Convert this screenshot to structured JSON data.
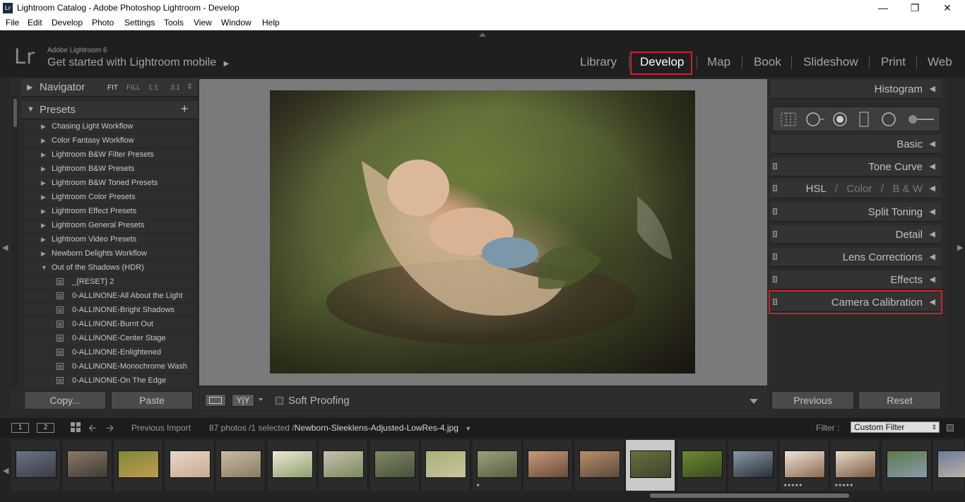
{
  "window": {
    "title": "Lightroom Catalog - Adobe Photoshop Lightroom - Develop",
    "app_icon": "Lr",
    "controls": {
      "minimize": "—",
      "restore": "❐",
      "close": "✕"
    }
  },
  "menu": [
    "File",
    "Edit",
    "Develop",
    "Photo",
    "Settings",
    "Tools",
    "View",
    "Window",
    "Help"
  ],
  "identity": {
    "logo": "Lr",
    "brand": "Adobe Lightroom 6",
    "mobile_prompt": "Get started with Lightroom mobile",
    "mobile_arrow": "▶"
  },
  "modules": [
    "Library",
    "Develop",
    "Map",
    "Book",
    "Slideshow",
    "Print",
    "Web"
  ],
  "active_module": "Develop",
  "left_panel": {
    "navigator": {
      "label": "Navigator",
      "options": [
        "FIT",
        "FILL",
        "1:1",
        "3:1"
      ],
      "selected": "FIT"
    },
    "presets": {
      "label": "Presets",
      "add": "+",
      "items": [
        {
          "name": "Chasing Light Workflow",
          "type": "folder"
        },
        {
          "name": "Color Fantasy Workflow",
          "type": "folder"
        },
        {
          "name": "Lightroom B&W Filter Presets",
          "type": "folder"
        },
        {
          "name": "Lightroom B&W Presets",
          "type": "folder"
        },
        {
          "name": "Lightroom B&W Toned Presets",
          "type": "folder"
        },
        {
          "name": "Lightroom Color Presets",
          "type": "folder"
        },
        {
          "name": "Lightroom Effect Presets",
          "type": "folder"
        },
        {
          "name": "Lightroom General Presets",
          "type": "folder"
        },
        {
          "name": "Lightroom Video Presets",
          "type": "folder"
        },
        {
          "name": "Newborn Delights Workflow",
          "type": "folder"
        },
        {
          "name": "Out of the Shadows (HDR)",
          "type": "folder-open"
        },
        {
          "name": "_{RESET} 2",
          "type": "preset"
        },
        {
          "name": "0-ALLINONE-All About the Light",
          "type": "preset"
        },
        {
          "name": "0-ALLINONE-Bright Shadows",
          "type": "preset"
        },
        {
          "name": "0-ALLINONE-Burnt Out",
          "type": "preset"
        },
        {
          "name": "0-ALLINONE-Center Stage",
          "type": "preset"
        },
        {
          "name": "0-ALLINONE-Enlightened",
          "type": "preset"
        },
        {
          "name": "0-ALLINONE-Monochrome Wash",
          "type": "preset"
        },
        {
          "name": "0-ALLINONE-On The Edge",
          "type": "preset"
        }
      ]
    },
    "copy_button": "Copy...",
    "paste_button": "Paste"
  },
  "toolbar": {
    "soft_proofing": "Soft Proofing",
    "soft_proofing_checked": false,
    "compare_label": "Y|Y"
  },
  "right_panel": {
    "histogram": "Histogram",
    "panels": [
      {
        "label": "Basic",
        "switch": false
      },
      {
        "label": "Tone Curve",
        "switch": true
      },
      {
        "label": "HSL",
        "extra": [
          "Color",
          "B & W"
        ],
        "switch": true
      },
      {
        "label": "Split Toning",
        "switch": true
      },
      {
        "label": "Detail",
        "switch": true
      },
      {
        "label": "Lens Corrections",
        "switch": true
      },
      {
        "label": "Effects",
        "switch": true
      },
      {
        "label": "Camera Calibration",
        "switch": true,
        "highlighted": true
      }
    ],
    "tools": [
      "crop-icon",
      "spot-removal-icon",
      "red-eye-icon",
      "graduated-filter-icon",
      "radial-filter-icon",
      "adjustment-brush-icon"
    ],
    "previous_button": "Previous",
    "reset_button": "Reset"
  },
  "filmstrip": {
    "view1": "1",
    "view2": "2",
    "source": "Previous Import",
    "count": "87 photos /1 selected /",
    "filename": "Newborn-Sleeklens-Adjusted-LowRes-4.jpg",
    "filter_label": "Filter :",
    "filter_value": "Custom Filter",
    "thumbnails": [
      {
        "colors": [
          "#6a7586",
          "#3a3a44"
        ],
        "stars": ""
      },
      {
        "colors": [
          "#8a7a66",
          "#3d3a35"
        ],
        "stars": ""
      },
      {
        "colors": [
          "#7c8a3a",
          "#c29a4e"
        ],
        "stars": ""
      },
      {
        "colors": [
          "#e8d8c8",
          "#c8a890"
        ],
        "stars": ""
      },
      {
        "colors": [
          "#c8bca6",
          "#8a7a62"
        ],
        "stars": ""
      },
      {
        "colors": [
          "#eee8d8",
          "#8ea06a"
        ],
        "stars": ""
      },
      {
        "colors": [
          "#c8c0b0",
          "#7a8a5a"
        ],
        "stars": ""
      },
      {
        "colors": [
          "#7f8a66",
          "#4a5038"
        ],
        "stars": ""
      },
      {
        "colors": [
          "#a8b07a",
          "#c8c49a"
        ],
        "stars": ""
      },
      {
        "colors": [
          "#9aa07a",
          "#5a6040"
        ],
        "stars": "★"
      },
      {
        "colors": [
          "#c89a7a",
          "#6a4a3a"
        ],
        "stars": ""
      },
      {
        "colors": [
          "#b8906a",
          "#5a4a3a"
        ],
        "stars": ""
      },
      {
        "colors": [
          "#6a7040",
          "#3e4228"
        ],
        "stars": "",
        "selected": true
      },
      {
        "colors": [
          "#6a8a30",
          "#3a4a20"
        ],
        "stars": ""
      },
      {
        "colors": [
          "#8a9aaa",
          "#2a2e34"
        ],
        "stars": ""
      },
      {
        "colors": [
          "#f0e4d8",
          "#8a6a50"
        ],
        "stars": "★★★★★"
      },
      {
        "colors": [
          "#e8dcc8",
          "#7a5a40"
        ],
        "stars": "★★★★★"
      },
      {
        "colors": [
          "#5a7a4a",
          "#8a9aaa"
        ],
        "stars": ""
      },
      {
        "colors": [
          "#6a7a9a",
          "#c8b8a8"
        ],
        "stars": ""
      }
    ]
  }
}
